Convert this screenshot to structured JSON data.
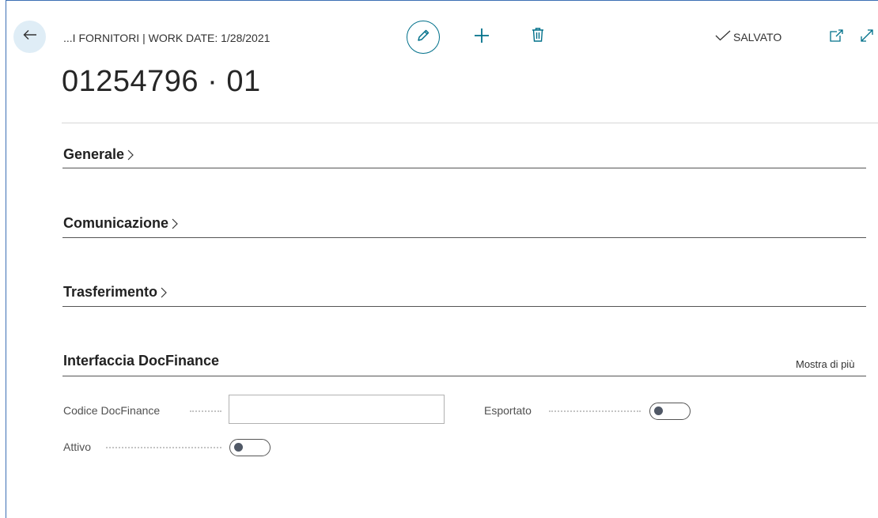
{
  "header": {
    "caption": "...I FORNITORI | WORK DATE: 1/28/2021",
    "title": "01254796 · 01",
    "saved_status": "SALVATO",
    "icons": {
      "back": "back-arrow-icon",
      "edit": "pencil-icon",
      "new": "plus-icon",
      "delete": "trash-icon",
      "saved": "checkmark-icon",
      "popout": "open-new-window-icon",
      "expand": "expand-icon"
    }
  },
  "sections": {
    "generale": "Generale",
    "comunicazione": "Comunicazione",
    "trasferimento": "Trasferimento",
    "docfinance": {
      "title": "Interfaccia DocFinance",
      "show_more": "Mostra di più",
      "fields": {
        "codice_label": "Codice DocFinance",
        "codice_value": "",
        "attivo_label": "Attivo",
        "attivo_on": false,
        "esportato_label": "Esportato",
        "esportato_on": false
      }
    }
  },
  "colors": {
    "accent": "#00708a",
    "back_button_bg": "#dfedf6",
    "frame": "#3c6fb4"
  }
}
